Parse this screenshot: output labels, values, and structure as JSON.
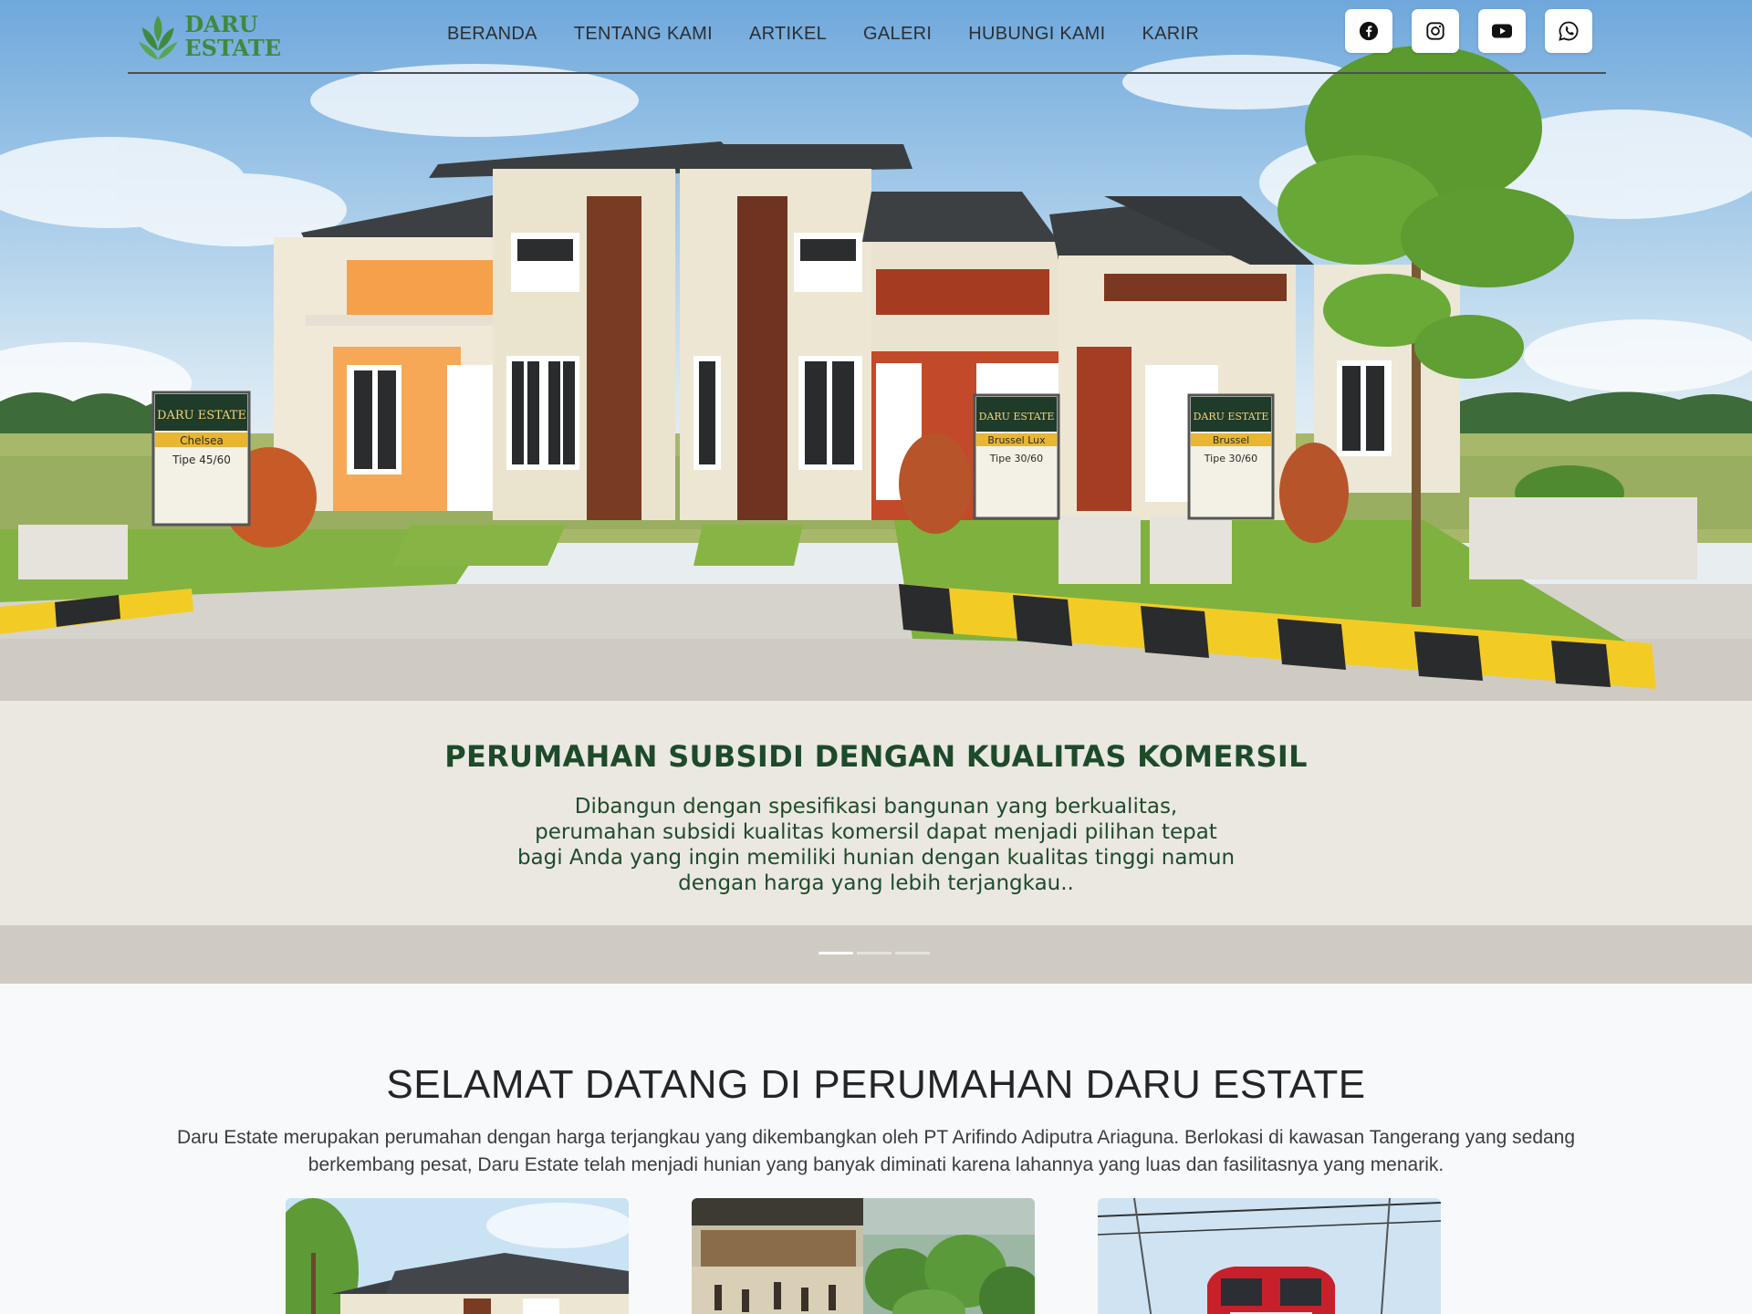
{
  "brand": {
    "line1": "DARU",
    "line2": "ESTATE"
  },
  "nav": {
    "items": [
      {
        "label": "BERANDA"
      },
      {
        "label": "TENTANG KAMI"
      },
      {
        "label": "ARTIKEL"
      },
      {
        "label": "GALERI"
      },
      {
        "label": "HUBUNGI KAMI"
      },
      {
        "label": "KARIR"
      }
    ]
  },
  "socials": [
    {
      "icon": "facebook-icon"
    },
    {
      "icon": "instagram-icon"
    },
    {
      "icon": "youtube-icon"
    },
    {
      "icon": "whatsapp-icon"
    }
  ],
  "hero": {
    "title": "PERUMAHAN SUBSIDI DENGAN KUALITAS KOMERSIL",
    "text": "Dibangun dengan spesifikasi bangunan yang berkualitas, perumahan subsidi kualitas komersil dapat menjadi pilihan tepat bagi Anda yang ingin memiliki hunian dengan kualitas tinggi namun dengan harga yang lebih terjangkau..",
    "slides": 3,
    "active_slide": 1,
    "signs": [
      {
        "brand": "DARU ESTATE",
        "model": "Chelsea",
        "type": "Tipe 45/60"
      },
      {
        "brand": "DARU ESTATE",
        "model": "Brussel Lux",
        "type": "Tipe 30/60"
      },
      {
        "brand": "DARU ESTATE",
        "model": "Brussel",
        "type": "Tipe 30/60"
      }
    ]
  },
  "welcome": {
    "title": "SELAMAT DATANG DI PERUMAHAN DARU ESTATE",
    "text": "Daru Estate merupakan perumahan dengan harga terjangkau yang dikembangkan oleh PT Arifindo Adiputra Ariaguna. Berlokasi di kawasan Tangerang yang sedang berkembang pesat, Daru Estate telah menjadi hunian yang banyak diminati karena lahannya yang luas dan fasilitasnya yang menarik."
  },
  "colors": {
    "brand_green": "#3d8a3f",
    "caption_green": "#1d4a2b",
    "nav_text": "#2b2f33"
  }
}
